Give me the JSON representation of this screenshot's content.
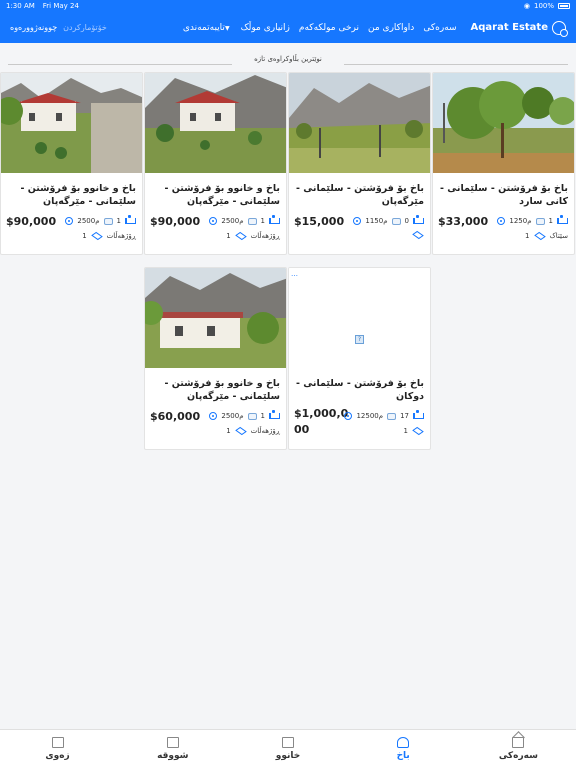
{
  "status_bar": {
    "time": "1:30 AM",
    "date": "Fri May 24",
    "battery": "100%"
  },
  "navbar": {
    "brand": "Aqarat Estate",
    "links": [
      "سەرەکی",
      "داواکاری من",
      "نرخی مولکەکەم",
      "زانیاری موڵک",
      "تایبەتمەندی"
    ],
    "left_items": [
      "چوونەژوورەوە",
      "خۆتۆمارکردن"
    ]
  },
  "section": {
    "title": "نوێترین بڵاوکراوەی تازە"
  },
  "listings": [
    {
      "title": "باخ بۆ فرۆشتن - سلێمانی - کانی سارد",
      "price": "$33,000",
      "beds": "1",
      "area": "1250م",
      "baths": "1",
      "extra": "سێتاک",
      "image": "trees-garden"
    },
    {
      "title": "باخ بۆ فرۆشتن - سلێمانی - مێرگەپان",
      "price": "$15,000",
      "beds": "0",
      "area": "1150م",
      "baths": "",
      "extra": "",
      "image": "mountain-field"
    },
    {
      "title": "باخ و خانوو بۆ فرۆشتن - سلێمانی - مێرگەپان",
      "price": "$90,000",
      "beds": "1",
      "area": "2500م",
      "baths": "1",
      "extra": "ڕۆژهەڵات",
      "image": "villa-mountain"
    },
    {
      "title": "باخ و خانوو بۆ فرۆشتن - سلێمانی - مێرگەپان",
      "price": "$90,000",
      "beds": "1",
      "area": "2500م",
      "baths": "1",
      "extra": "ڕۆژهەڵات",
      "image": "villa-garden"
    },
    {
      "title": "باخ بۆ فرۆشتن - سلێمانی - دوکان",
      "price": "$1,000,000",
      "beds": "17",
      "area": "12500م",
      "baths": "1",
      "extra": "",
      "image": "broken"
    },
    {
      "title": "باخ و خانوو بۆ فرۆشتن - سلێمانی - مێرگەپان",
      "price": "$60,000",
      "beds": "1",
      "area": "2500م",
      "baths": "1",
      "extra": "ڕۆژهەڵات",
      "image": "house-mountain"
    }
  ],
  "tabs": [
    {
      "label": "سەرەکی",
      "icon": "home-icon",
      "active": false
    },
    {
      "label": "باخ",
      "icon": "tree-icon",
      "active": true
    },
    {
      "label": "خانوو",
      "icon": "house-icon",
      "active": false
    },
    {
      "label": "شووقە",
      "icon": "building-icon",
      "active": false
    },
    {
      "label": "زەوی",
      "icon": "land-icon",
      "active": false
    }
  ],
  "colors": {
    "primary": "#1677ff",
    "background": "#f4f5f7"
  }
}
